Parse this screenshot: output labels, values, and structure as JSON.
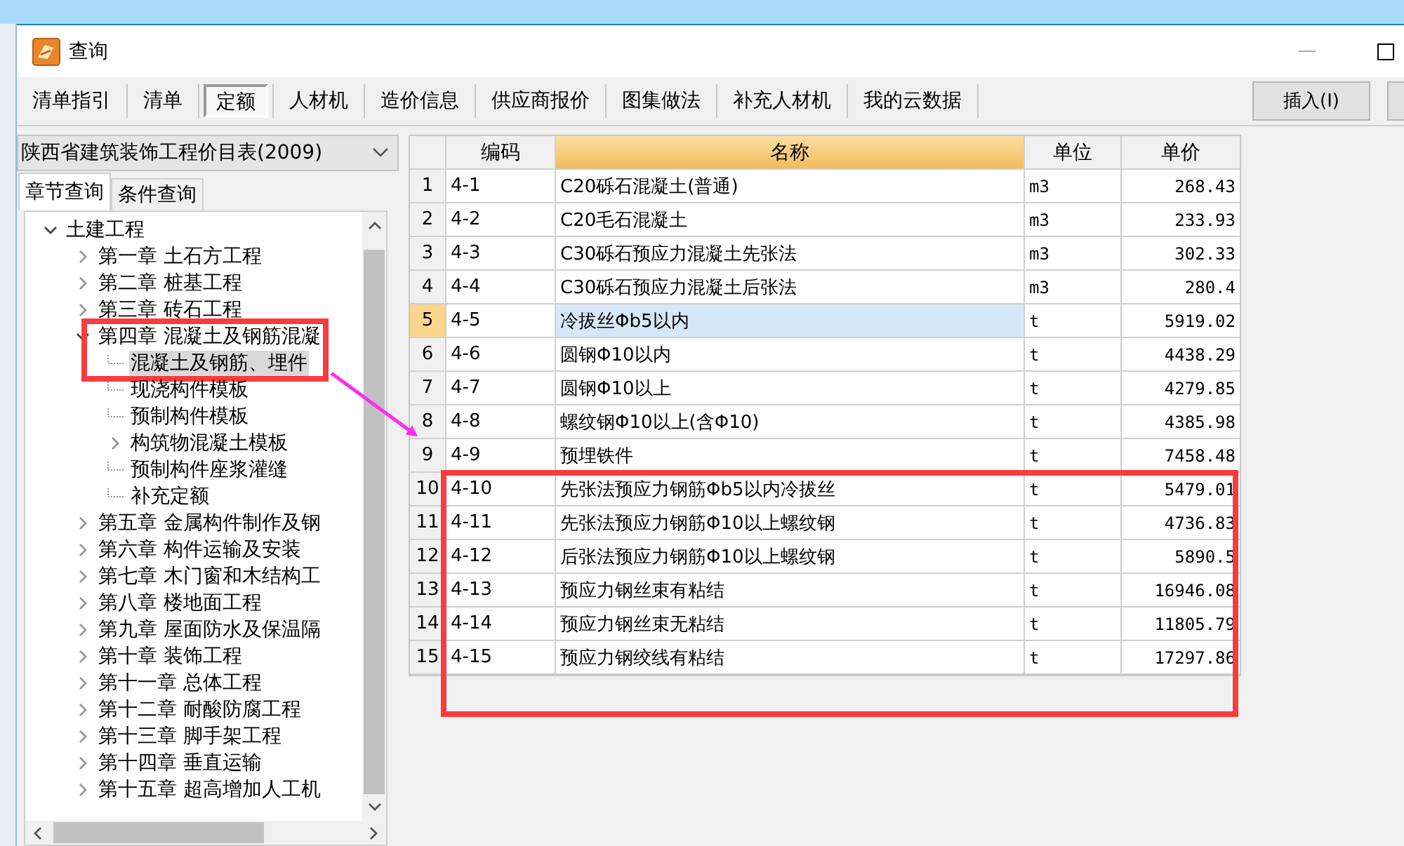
{
  "window": {
    "title": "查询"
  },
  "tabs": [
    {
      "label": "清单指引",
      "selected": false
    },
    {
      "label": "清单",
      "selected": false
    },
    {
      "label": "定额",
      "selected": true
    },
    {
      "label": "人材机",
      "selected": false
    },
    {
      "label": "造价信息",
      "selected": false
    },
    {
      "label": "供应商报价",
      "selected": false
    },
    {
      "label": "图集做法",
      "selected": false
    },
    {
      "label": "补充人材机",
      "selected": false
    },
    {
      "label": "我的云数据",
      "selected": false
    }
  ],
  "insert_button": "插入(I)",
  "library": {
    "value": "陕西省建筑装饰工程价目表(2009)"
  },
  "subtabs": [
    {
      "label": "章节查询",
      "selected": true
    },
    {
      "label": "条件查询",
      "selected": false
    }
  ],
  "tree": [
    {
      "label": "土建工程",
      "expanded": true,
      "selected": false,
      "children": [
        {
          "label": "第一章  土石方工程",
          "expanded": false,
          "selected": false
        },
        {
          "label": "第二章  桩基工程",
          "expanded": false,
          "selected": false
        },
        {
          "label": "第三章  砖石工程",
          "expanded": false,
          "selected": false
        },
        {
          "label": "第四章  混凝土及钢筋混凝",
          "expanded": true,
          "selected": false,
          "children": [
            {
              "label": "混凝土及钢筋、埋件",
              "selected": true
            },
            {
              "label": "现浇构件模板",
              "selected": false
            },
            {
              "label": "预制构件模板",
              "selected": false
            },
            {
              "label": "构筑物混凝土模板",
              "expanded": false,
              "selected": false
            },
            {
              "label": "预制构件座浆灌缝",
              "selected": false
            },
            {
              "label": "补充定额",
              "selected": false
            }
          ]
        },
        {
          "label": "第五章  金属构件制作及钢",
          "expanded": false,
          "selected": false
        },
        {
          "label": "第六章  构件运输及安装",
          "expanded": false,
          "selected": false
        },
        {
          "label": "第七章  木门窗和木结构工",
          "expanded": false,
          "selected": false
        },
        {
          "label": "第八章  楼地面工程",
          "expanded": false,
          "selected": false
        },
        {
          "label": "第九章  屋面防水及保温隔",
          "expanded": false,
          "selected": false
        },
        {
          "label": "第十章  装饰工程",
          "expanded": false,
          "selected": false
        },
        {
          "label": "第十一章  总体工程",
          "expanded": false,
          "selected": false
        },
        {
          "label": "第十二章  耐酸防腐工程",
          "expanded": false,
          "selected": false
        },
        {
          "label": "第十三章  脚手架工程",
          "expanded": false,
          "selected": false
        },
        {
          "label": "第十四章  垂直运输",
          "expanded": false,
          "selected": false
        },
        {
          "label": "第十五章  超高增加人工机",
          "expanded": false,
          "selected": false
        }
      ]
    }
  ],
  "table": {
    "columns": [
      {
        "label": "编码",
        "selected": false
      },
      {
        "label": "名称",
        "selected": true
      },
      {
        "label": "单位",
        "selected": false
      },
      {
        "label": "单价",
        "selected": false
      }
    ],
    "rows": [
      {
        "number": "1",
        "code": "4-1",
        "name": "C20砾石混凝土(普通)",
        "unit": "m3",
        "price": "268.43",
        "selected": false
      },
      {
        "number": "2",
        "code": "4-2",
        "name": "C20毛石混凝土",
        "unit": "m3",
        "price": "233.93",
        "selected": false
      },
      {
        "number": "3",
        "code": "4-3",
        "name": "C30砾石预应力混凝土先张法",
        "unit": "m3",
        "price": "302.33",
        "selected": false
      },
      {
        "number": "4",
        "code": "4-4",
        "name": "C30砾石预应力混凝土后张法",
        "unit": "m3",
        "price": "280.4",
        "selected": false
      },
      {
        "number": "5",
        "code": "4-5",
        "name": "冷拔丝Φb5以内",
        "unit": "t",
        "price": "5919.02",
        "selected": true
      },
      {
        "number": "6",
        "code": "4-6",
        "name": "圆钢Φ10以内",
        "unit": "t",
        "price": "4438.29",
        "selected": false
      },
      {
        "number": "7",
        "code": "4-7",
        "name": "圆钢Φ10以上",
        "unit": "t",
        "price": "4279.85",
        "selected": false
      },
      {
        "number": "8",
        "code": "4-8",
        "name": "螺纹钢Φ10以上(含Φ10)",
        "unit": "t",
        "price": "4385.98",
        "selected": false
      },
      {
        "number": "9",
        "code": "4-9",
        "name": "预埋铁件",
        "unit": "t",
        "price": "7458.48",
        "selected": false
      },
      {
        "number": "10",
        "code": "4-10",
        "name": "先张法预应力钢筋Φb5以内冷拔丝",
        "unit": "t",
        "price": "5479.01",
        "selected": false
      },
      {
        "number": "11",
        "code": "4-11",
        "name": "先张法预应力钢筋Φ10以上螺纹钢",
        "unit": "t",
        "price": "4736.83",
        "selected": false
      },
      {
        "number": "12",
        "code": "4-12",
        "name": "后张法预应力钢筋Φ10以上螺纹钢",
        "unit": "t",
        "price": "5890.5",
        "selected": false
      },
      {
        "number": "13",
        "code": "4-13",
        "name": "预应力钢丝束有粘结",
        "unit": "t",
        "price": "16946.08",
        "selected": false
      },
      {
        "number": "14",
        "code": "4-14",
        "name": "预应力钢丝束无粘结",
        "unit": "t",
        "price": "11805.79",
        "selected": false
      },
      {
        "number": "15",
        "code": "4-15",
        "name": "预应力钢绞线有粘结",
        "unit": "t",
        "price": "17297.86",
        "selected": false
      }
    ]
  }
}
